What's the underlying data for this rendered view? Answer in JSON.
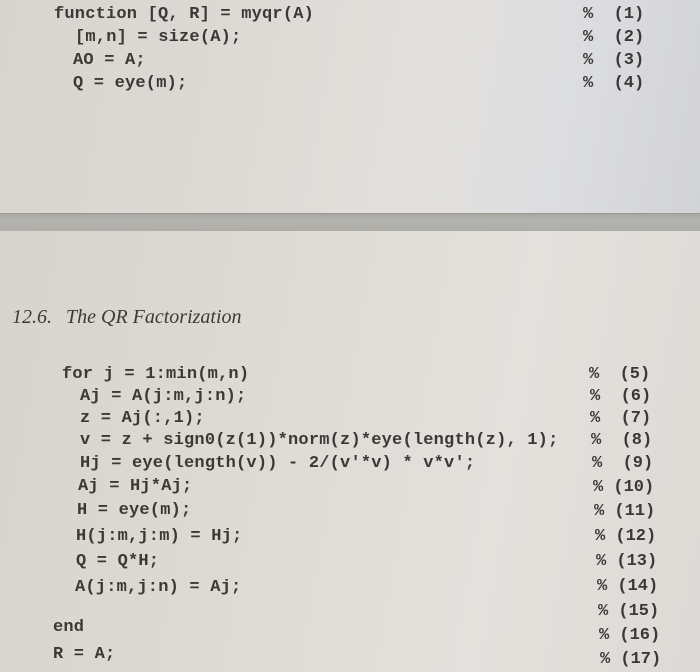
{
  "top_page": {
    "lines": [
      {
        "code": "function [Q, R] = myqr(A)",
        "comment": "%  (1)"
      },
      {
        "code": "[m,n] = size(A);",
        "comment": "%  (2)"
      },
      {
        "code": "AO = A;",
        "comment": "%  (3)"
      },
      {
        "code": "Q = eye(m);",
        "comment": "%  (4)"
      }
    ]
  },
  "bottom_page": {
    "section_number": "12.6.",
    "section_title": "The QR Factorization",
    "lines": [
      {
        "code": "for j = 1:min(m,n)",
        "comment": "%  (5)"
      },
      {
        "code": "Aj = A(j:m,j:n);",
        "comment": "%  (6)"
      },
      {
        "code": "z = Aj(:,1);",
        "comment": "%  (7)"
      },
      {
        "code": "v = z + sign0(z(1))*norm(z)*eye(length(z), 1);",
        "comment": "%  (8)"
      },
      {
        "code": "Hj = eye(length(v)) - 2/(v'*v) * v*v';",
        "comment": "%  (9)"
      },
      {
        "code": "Aj = Hj*Aj;",
        "comment": "% (10)"
      },
      {
        "code": "H = eye(m);",
        "comment": "% (11)"
      },
      {
        "code": "H(j:m,j:m) = Hj;",
        "comment": "% (12)"
      },
      {
        "code": "Q = Q*H;",
        "comment": "% (13)"
      },
      {
        "code": "A(j:m,j:n) = Aj;",
        "comment": "% (14)"
      },
      {
        "code": "",
        "comment": "% (15)"
      },
      {
        "code": "end",
        "comment": "% (16)"
      },
      {
        "code": "R = A;",
        "comment": "% (17)"
      }
    ]
  }
}
